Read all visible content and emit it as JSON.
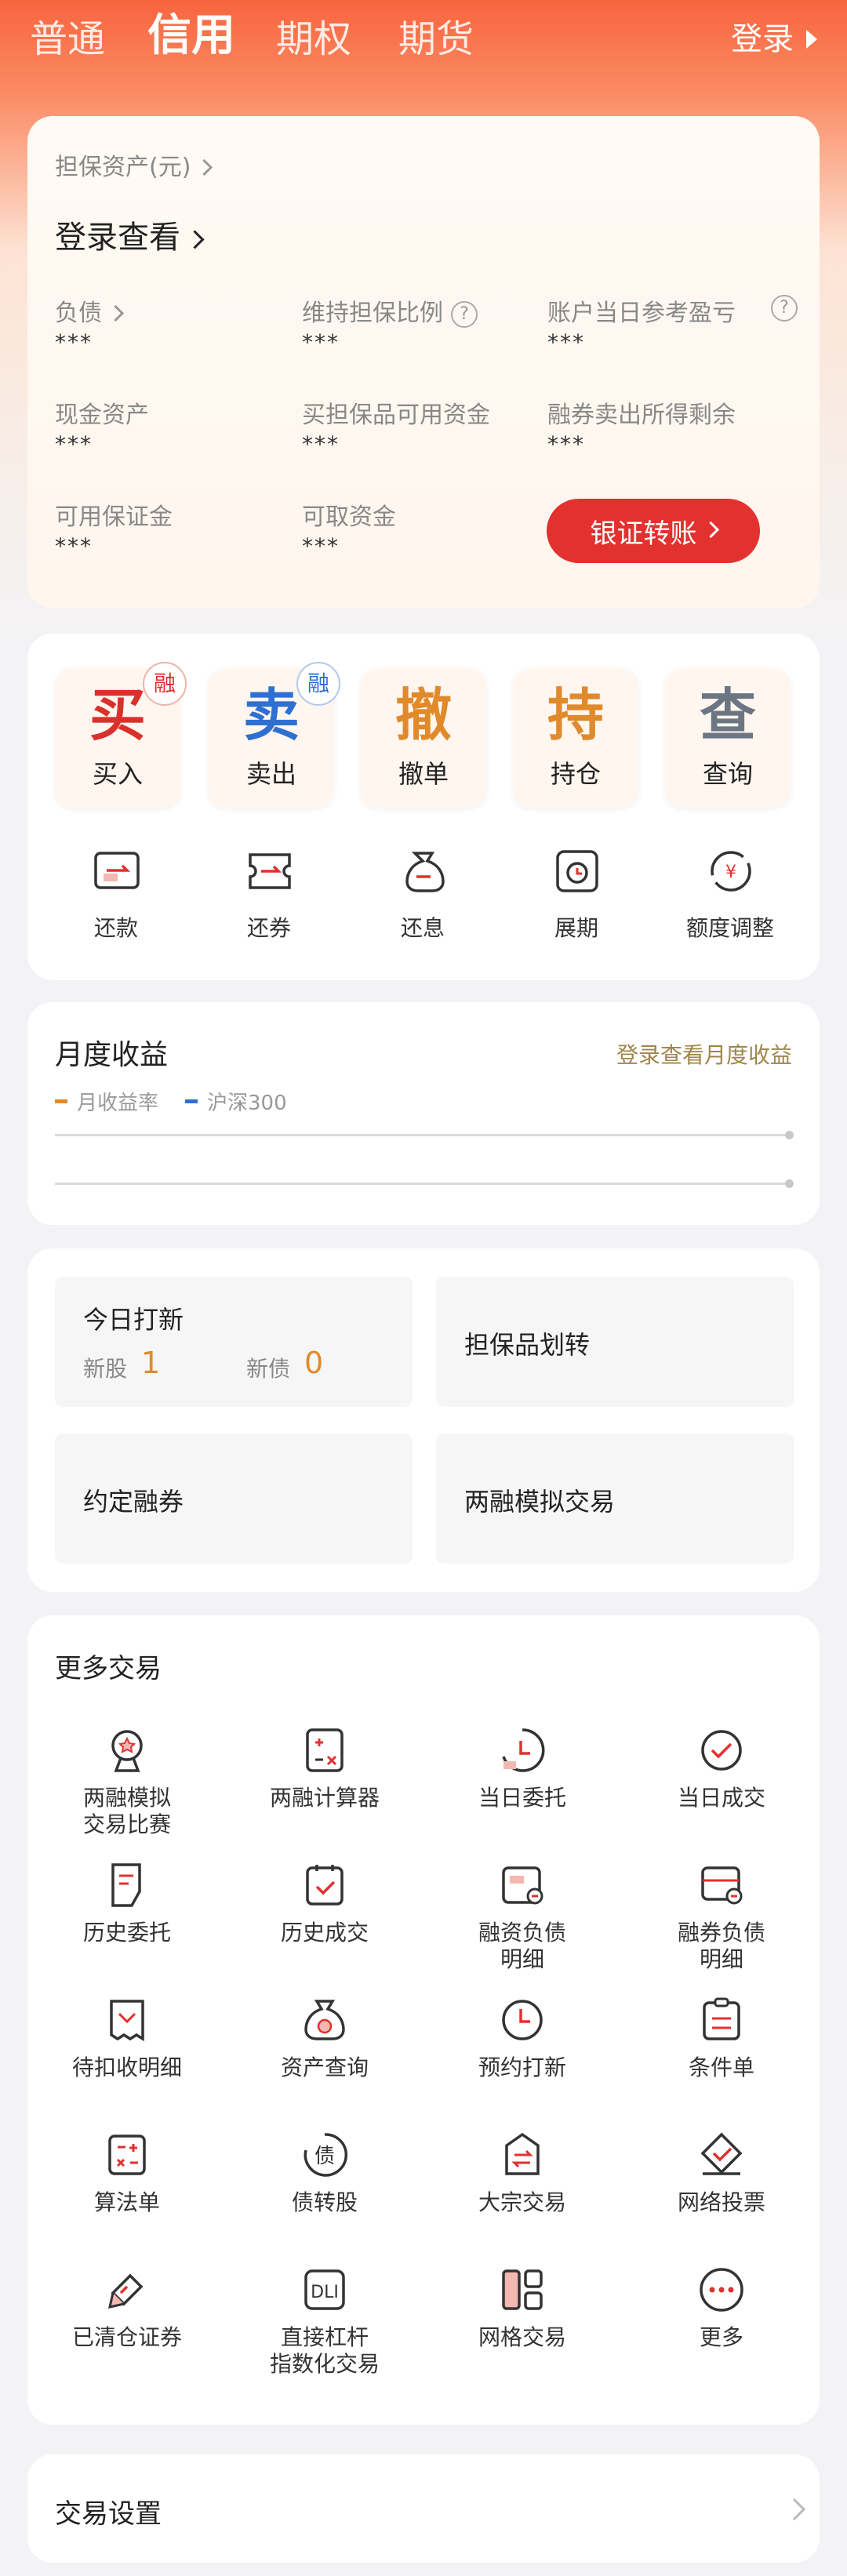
{
  "tabs": [
    "普通",
    "信用",
    "期权",
    "期货"
  ],
  "login_top": "登录",
  "asset": {
    "title": "担保资产(元)",
    "login_view": "登录查看",
    "fields": [
      {
        "label": "负债",
        "value": "***"
      },
      {
        "label": "维持担保比例",
        "value": "***"
      },
      {
        "label": "账户当日参考盈亏",
        "value": "***"
      },
      {
        "label": "现金资产",
        "value": "***"
      },
      {
        "label": "买担保品可用资金",
        "value": "***"
      },
      {
        "label": "融券卖出所得剩余",
        "value": "***"
      },
      {
        "label": "可用保证金",
        "value": "***"
      },
      {
        "label": "可取资金",
        "value": "***"
      }
    ],
    "transfer_button": "银证转账"
  },
  "actions": {
    "big": [
      {
        "char": "买",
        "label": "买入",
        "badge": "融",
        "color": "#d9302b"
      },
      {
        "char": "卖",
        "label": "卖出",
        "badge": "融",
        "color": "#2f6fd1"
      },
      {
        "char": "撤",
        "label": "撤单",
        "badge": "",
        "color": "#e08a2c"
      },
      {
        "char": "持",
        "label": "持仓",
        "badge": "",
        "color": "#e08a2c"
      },
      {
        "char": "查",
        "label": "查询",
        "badge": "",
        "color": "#6c7683"
      }
    ],
    "small": [
      {
        "label": "还款",
        "icon": "repay-icon"
      },
      {
        "label": "还券",
        "icon": "return-stock-icon"
      },
      {
        "label": "还息",
        "icon": "interest-bag-icon"
      },
      {
        "label": "展期",
        "icon": "extend-clock-icon"
      },
      {
        "label": "额度调整",
        "icon": "quota-adjust-icon"
      }
    ]
  },
  "monthly": {
    "title": "月度收益",
    "link": "登录查看月度收益",
    "legend": [
      {
        "name": "月收益率",
        "color": "#e08a2c"
      },
      {
        "name": "沪深300",
        "color": "#2f6fd1"
      }
    ]
  },
  "quick": {
    "ipo_title": "今日打新",
    "ipo_stock_label": "新股",
    "ipo_stock_value": "1",
    "ipo_bond_label": "新债",
    "ipo_bond_value": "0",
    "collateral_transfer": "担保品划转",
    "agreed_lending": "约定融券",
    "simulation": "两融模拟交易"
  },
  "more": {
    "title": "更多交易",
    "items": [
      {
        "label": "两融模拟\n交易比赛",
        "icon": "medal-icon"
      },
      {
        "label": "两融计算器",
        "icon": "calculator-icon"
      },
      {
        "label": "当日委托",
        "icon": "today-order-icon"
      },
      {
        "label": "当日成交",
        "icon": "today-deal-icon"
      },
      {
        "label": "历史委托",
        "icon": "history-order-icon"
      },
      {
        "label": "历史成交",
        "icon": "history-deal-icon"
      },
      {
        "label": "融资负债\n明细",
        "icon": "finance-debt-icon"
      },
      {
        "label": "融券负债\n明细",
        "icon": "lending-debt-icon"
      },
      {
        "label": "待扣收明细",
        "icon": "pending-deduct-icon"
      },
      {
        "label": "资产查询",
        "icon": "asset-query-icon"
      },
      {
        "label": "预约打新",
        "icon": "reserve-ipo-icon"
      },
      {
        "label": "条件单",
        "icon": "condition-order-icon"
      },
      {
        "label": "算法单",
        "icon": "algo-order-icon"
      },
      {
        "label": "债转股",
        "icon": "bond-convert-icon"
      },
      {
        "label": "大宗交易",
        "icon": "block-trade-icon"
      },
      {
        "label": "网络投票",
        "icon": "online-vote-icon"
      },
      {
        "label": "已清仓证券",
        "icon": "cleared-stock-icon"
      },
      {
        "label": "直接杠杆\n指数化交易",
        "icon": "leverage-index-icon"
      },
      {
        "label": "网格交易",
        "icon": "grid-trade-icon"
      },
      {
        "label": "更多",
        "icon": "more-icon"
      }
    ]
  },
  "settings": {
    "label": "交易设置"
  }
}
